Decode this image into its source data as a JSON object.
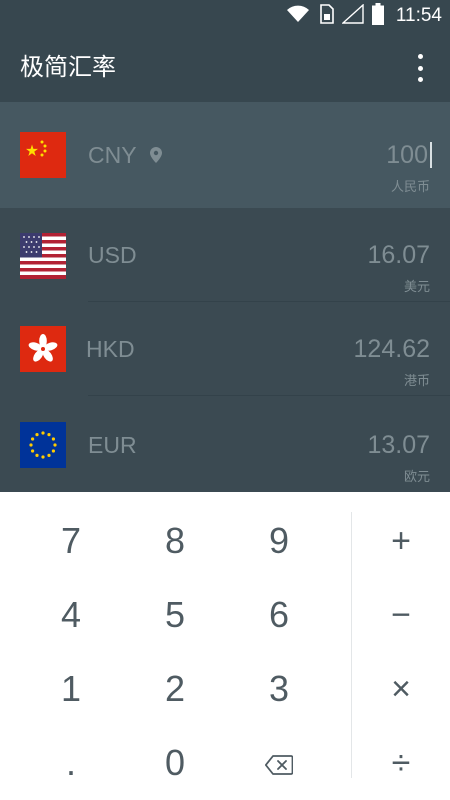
{
  "status_bar": {
    "time": "11:54",
    "icons": [
      "wifi-icon",
      "sim-card-icon",
      "cellular-signal-icon",
      "battery-icon"
    ]
  },
  "app_bar": {
    "title": "极简汇率",
    "menu_icon": "more-vertical-icon"
  },
  "currencies": [
    {
      "code": "CNY",
      "amount": "100",
      "name": "人民币",
      "flag": "china-flag-icon",
      "selected": true,
      "location_icon": "location-pin-icon"
    },
    {
      "code": "USD",
      "amount": "16.07",
      "name": "美元",
      "flag": "usa-flag-icon",
      "selected": false
    },
    {
      "code": "HKD",
      "amount": "124.62",
      "name": "港币",
      "flag": "hong-kong-flag-icon",
      "selected": false
    },
    {
      "code": "EUR",
      "amount": "13.07",
      "name": "欧元",
      "flag": "eu-flag-icon",
      "selected": false
    }
  ],
  "keypad": {
    "digits": {
      "seven": "7",
      "eight": "8",
      "nine": "9",
      "four": "4",
      "five": "5",
      "six": "6",
      "one": "1",
      "two": "2",
      "three": "3",
      "dot": ".",
      "zero": "0"
    },
    "backspace_icon": "backspace-icon",
    "operators": {
      "add": "+",
      "subtract": "−",
      "multiply": "×",
      "divide": "÷"
    }
  },
  "colors": {
    "app_bar": "#37474f",
    "list_background": "#3b4a52",
    "selected_row": "#465861",
    "muted_text": "#7f8d93",
    "keypad_text": "#4f5b62"
  }
}
